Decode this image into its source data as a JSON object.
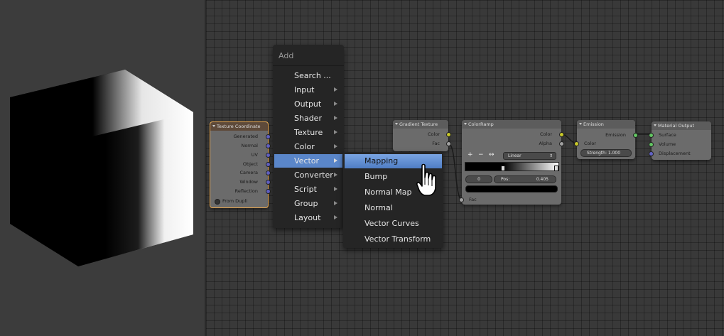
{
  "texture_coordinate": {
    "title": "Texture Coordinate",
    "outputs": [
      "Generated",
      "Normal",
      "UV",
      "Object",
      "Camera",
      "Window",
      "Reflection"
    ],
    "from_dupli": "From Dupli"
  },
  "add_menu": {
    "title": "Add",
    "items": [
      {
        "label": "Search ...",
        "submenu": false
      },
      {
        "label": "Input",
        "submenu": true
      },
      {
        "label": "Output",
        "submenu": true
      },
      {
        "label": "Shader",
        "submenu": true
      },
      {
        "label": "Texture",
        "submenu": true
      },
      {
        "label": "Color",
        "submenu": true
      },
      {
        "label": "Vector",
        "submenu": true,
        "active": true
      },
      {
        "label": "Converter",
        "submenu": true
      },
      {
        "label": "Script",
        "submenu": true
      },
      {
        "label": "Group",
        "submenu": true
      },
      {
        "label": "Layout",
        "submenu": true
      }
    ]
  },
  "vector_submenu": {
    "items": [
      "Mapping",
      "Bump",
      "Normal Map",
      "Normal",
      "Vector Curves",
      "Vector Transform"
    ],
    "active_index": 0
  },
  "gradient_texture": {
    "title": "Gradient Texture",
    "outputs": [
      "Color",
      "Fac"
    ]
  },
  "colorramp": {
    "title": "ColorRamp",
    "outputs": [
      "Color",
      "Alpha"
    ],
    "add": "+",
    "remove": "−",
    "flip": "↔",
    "interpolation": "Linear",
    "index": "0",
    "pos_label": "Pos:",
    "pos_value": "0.405",
    "input": "Fac",
    "stop_position": 0.405
  },
  "emission": {
    "title": "Emission",
    "output": "Emission",
    "input": "Color",
    "strength": "Strength: 1.000"
  },
  "material_output": {
    "title": "Material Output",
    "inputs": [
      "Surface",
      "Volume",
      "Displacement"
    ]
  },
  "colors": {
    "menu_highlight": "#5a86c9",
    "node_selected_border": "#e8a74e",
    "socket_vector": "#6363c7",
    "socket_color": "#c7c729",
    "socket_shader": "#63c763"
  }
}
